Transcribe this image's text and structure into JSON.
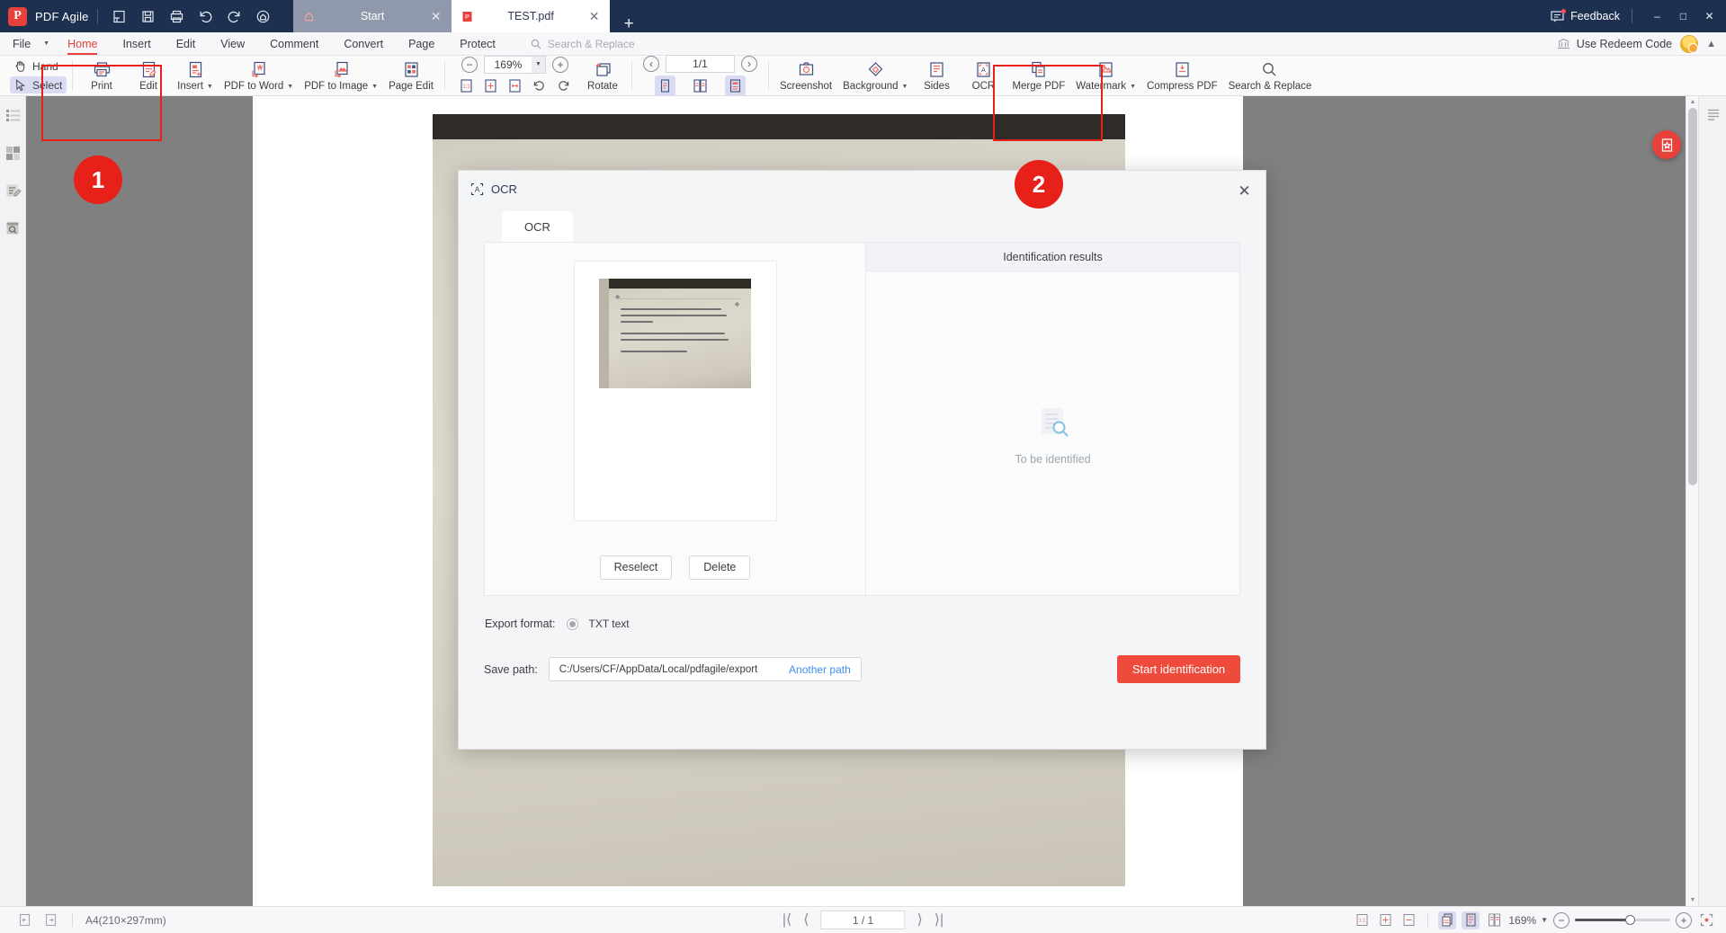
{
  "titlebar": {
    "brand_initial": "P",
    "brand_name": "PDF Agile",
    "quick_icons": [
      "open-file-icon",
      "save-icon",
      "print-icon",
      "undo-icon",
      "redo-icon",
      "home-circle-icon"
    ],
    "tabs": [
      {
        "label": "Start",
        "favicon": "home-icon",
        "active": false
      },
      {
        "label": "TEST.pdf",
        "favicon": "pdf-file-icon",
        "active": true
      }
    ],
    "new_tab": "+",
    "feedback": "Feedback",
    "window_buttons": {
      "minimize": "–",
      "maximize": "□",
      "close": "✕"
    }
  },
  "menubar": {
    "items": [
      "File",
      "Home",
      "Insert",
      "Edit",
      "View",
      "Comment",
      "Convert",
      "Page",
      "Protect"
    ],
    "active": "Home",
    "search_placeholder": "Search & Replace",
    "redeem": "Use Redeem Code"
  },
  "ribbon": {
    "mode_tools": [
      {
        "label": "Hand",
        "icon": "hand-icon",
        "selected": false
      },
      {
        "label": "Select",
        "icon": "cursor-icon",
        "selected": true
      }
    ],
    "group1": [
      {
        "label": "Print",
        "icon": "print-icon",
        "caret": false
      },
      {
        "label": "Edit",
        "icon": "edit-doc-icon",
        "caret": false
      },
      {
        "label": "Insert",
        "icon": "insert-doc-icon",
        "caret": true
      },
      {
        "label": "PDF to Word",
        "icon": "pdf-to-word-icon",
        "caret": true
      },
      {
        "label": "PDF to Image",
        "icon": "pdf-to-image-icon",
        "caret": true
      },
      {
        "label": "Page Edit",
        "icon": "page-edit-icon",
        "caret": false
      }
    ],
    "zoom": {
      "value": "169%",
      "minus": "−",
      "plus": "+"
    },
    "fit_icons": [
      "actual-size-icon",
      "fit-page-icon",
      "fit-width-icon",
      "rotate-left-icon",
      "rotate-right-icon"
    ],
    "rotate": {
      "label": "Rotate",
      "icon": "rotate-pages-icon"
    },
    "page_nav": {
      "value": "1/1",
      "prev": "‹",
      "next": "›"
    },
    "view_icons": [
      "single-page-icon",
      "two-page-icon",
      "scroll-view-icon"
    ],
    "group2": [
      {
        "label": "Screenshot",
        "icon": "screenshot-icon",
        "caret": false
      },
      {
        "label": "Background",
        "icon": "background-icon",
        "caret": true
      },
      {
        "label": "Sides",
        "icon": "sides-icon",
        "caret": false
      },
      {
        "label": "OCR",
        "icon": "ocr-icon",
        "caret": false
      },
      {
        "label": "Merge PDF",
        "icon": "merge-pdf-icon",
        "caret": false
      },
      {
        "label": "Watermark",
        "icon": "watermark-icon",
        "caret": true
      },
      {
        "label": "Compress PDF",
        "icon": "compress-pdf-icon",
        "caret": false
      },
      {
        "label": "Search & Replace",
        "icon": "search-replace-icon",
        "caret": false
      }
    ]
  },
  "leftrail": {
    "items": [
      "outline-icon",
      "thumbnails-icon",
      "annotations-icon",
      "search-icon"
    ]
  },
  "annotations": [
    {
      "number": "1",
      "label": "step-1-badge"
    },
    {
      "number": "2",
      "label": "step-2-badge"
    }
  ],
  "modal": {
    "title": "OCR",
    "title_icon": "ocr-icon",
    "close": "✕",
    "tabs": [
      {
        "label": "OCR",
        "active": true
      }
    ],
    "left_pane": {
      "buttons": [
        {
          "label": "Reselect"
        },
        {
          "label": "Delete"
        }
      ]
    },
    "right_pane": {
      "header": "Identification results",
      "empty_icon": "document-search-icon",
      "empty_text": "To be identified"
    },
    "export_format": {
      "label": "Export format:",
      "option": "TXT text",
      "selected": true
    },
    "save_path": {
      "label": "Save path:",
      "value": "C:/Users/CF/AppData/Local/pdfagile/export",
      "link": "Another path"
    },
    "primary_button": "Start identification"
  },
  "statusbar": {
    "left_icons": [
      "prev-page-icon",
      "next-page-icon"
    ],
    "page_size": "A4(210×297mm)",
    "nav": {
      "first": "|⟨",
      "prev": "⟨",
      "value": "1 / 1",
      "next": "⟩",
      "last": "⟩|"
    },
    "right_icons": [
      "actual-size-icon",
      "fit-page-icon",
      "fit-width-icon",
      "single-page-icon",
      "continuous-icon",
      "two-page-icon"
    ],
    "zoom": "169%",
    "zoom_minus": "−",
    "zoom_plus": "+",
    "fullscreen_icon": "fullscreen-icon"
  },
  "colors": {
    "titlebar": "#1e3050",
    "accent_red": "#e8403a",
    "primary_button": "#ef4b3c",
    "annotation_red": "#e8201a",
    "link_blue": "#3d8ef5"
  }
}
